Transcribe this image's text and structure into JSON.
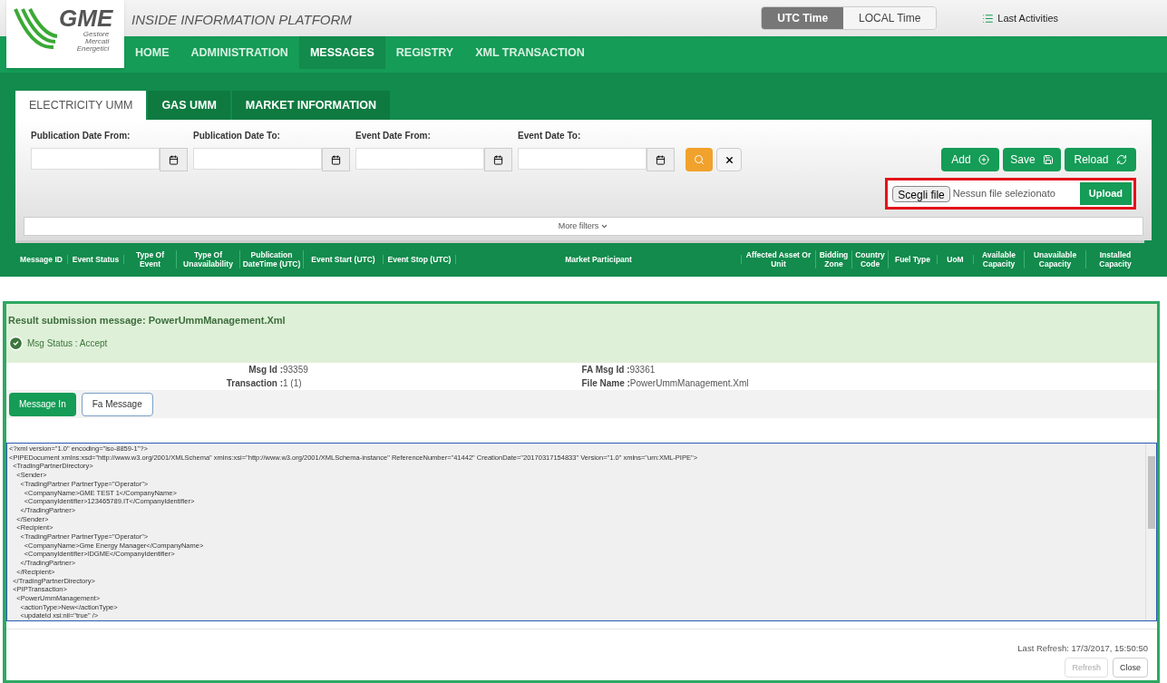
{
  "header": {
    "logo_text": "GME",
    "logo_subtitle": [
      "Gestore",
      "Mercati",
      "Energetici"
    ],
    "title": "INSIDE INFORMATION PLATFORM",
    "time_toggle": [
      {
        "label": "UTC Time",
        "selected": true
      },
      {
        "label": "LOCAL Time",
        "selected": false
      }
    ],
    "last_activities": "Last Activities"
  },
  "nav": [
    {
      "label": "HOME",
      "selected": false
    },
    {
      "label": "ADMINISTRATION",
      "selected": false
    },
    {
      "label": "MESSAGES",
      "selected": true
    },
    {
      "label": "REGISTRY",
      "selected": false
    },
    {
      "label": "XML TRANSACTION",
      "selected": false
    }
  ],
  "tabs": [
    {
      "label": "ELECTRICITY UMM",
      "selected": true
    },
    {
      "label": "GAS UMM",
      "selected": false
    },
    {
      "label": "MARKET INFORMATION",
      "selected": false
    }
  ],
  "filters": [
    {
      "label": "Publication Date From:"
    },
    {
      "label": "Publication Date To:"
    },
    {
      "label": "Event Date From:"
    },
    {
      "label": "Event Date To:"
    }
  ],
  "actions": [
    "Add",
    "Save",
    "Reload"
  ],
  "upload": {
    "choose": "Scegli file",
    "status": "Nessun file selezionato",
    "button": "Upload"
  },
  "more_filters": "More filters",
  "table": {
    "columns": [
      "Message ID",
      "Event Status",
      "Type Of Event",
      "Type Of Unavailability",
      "Publication DateTime (UTC)",
      "Event Start (UTC)",
      "Event Stop (UTC)",
      "Market Participant",
      "Affected Asset Or Unit",
      "Bidding Zone",
      "Country Code",
      "Fuel Type",
      "UoM",
      "Available Capacity",
      "Unavailable Capacity",
      "Installed Capacity"
    ]
  },
  "dialog": {
    "title": "Result submission message: PowerUmmManagement.Xml",
    "status": "Msg Status : Accept",
    "fields": [
      {
        "label": "Msg Id :",
        "value": "93359"
      },
      {
        "label": "FA Msg Id :",
        "value": "93361"
      },
      {
        "label": "Transaction :",
        "value": "1 (1)"
      },
      {
        "label": "File Name :",
        "value": "PowerUmmManagement.Xml"
      }
    ],
    "tabs": [
      {
        "label": "Message In",
        "selected": true
      },
      {
        "label": "Fa Message",
        "selected": false
      }
    ],
    "xml": [
      "<?xml version=\"1.0\" encoding=\"iso-8859-1\"?>",
      "<PIPEDocument xmlns:xsd=\"http://www.w3.org/2001/XMLSchema\" xmlns:xsi=\"http://www.w3.org/2001/XMLSchema-instance\" ReferenceNumber=\"41442\" CreationDate=\"20170317154833\" Version=\"1.0\" xmlns=\"urn:XML-PIPE\">",
      "  <TradingPartnerDirectory>",
      "    <Sender>",
      "      <TradingPartner PartnerType=\"Operator\">",
      "        <CompanyName>GME TEST 1</CompanyName>",
      "        <CompanyIdentifier>123465789.IT</CompanyIdentifier>",
      "      </TradingPartner>",
      "    </Sender>",
      "    <Recipient>",
      "      <TradingPartner PartnerType=\"Operator\">",
      "        <CompanyName>Gme Energy Manager</CompanyName>",
      "        <CompanyIdentifier>IDGME</CompanyIdentifier>",
      "      </TradingPartner>",
      "    </Recipient>",
      "  </TradingPartnerDirectory>",
      "  <PIPTransaction>",
      "    <PowerUmmManagement>",
      "      <actionType>New</actionType>",
      "      <updateId xsi:nil=\"true\" />"
    ],
    "last_refresh": "Last Refresh: 17/3/2017, 15:50:50",
    "buttons": [
      {
        "label": "Refresh",
        "disabled": true
      },
      {
        "label": "Close",
        "disabled": false
      }
    ]
  }
}
